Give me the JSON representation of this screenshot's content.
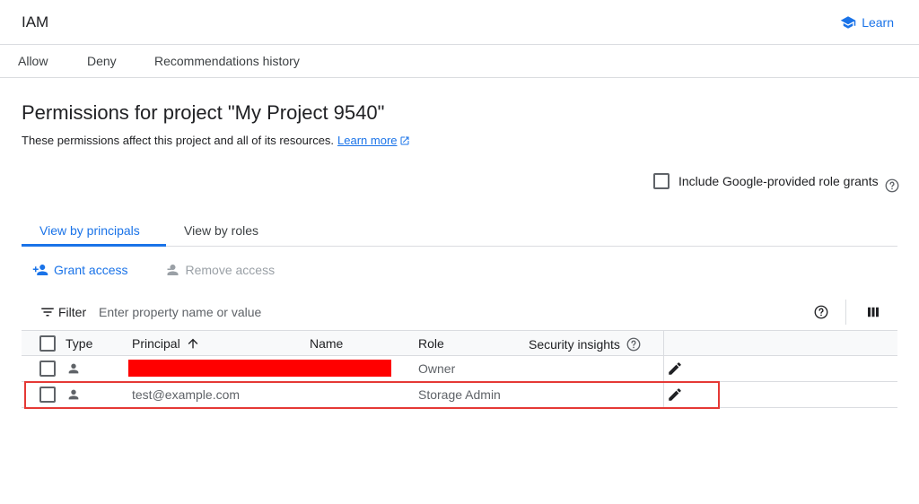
{
  "header": {
    "title": "IAM",
    "learn_label": "Learn"
  },
  "top_tabs": [
    {
      "label": "Allow"
    },
    {
      "label": "Deny"
    },
    {
      "label": "Recommendations history"
    }
  ],
  "page": {
    "title": "Permissions for project \"My Project 9540\"",
    "description": "These permissions affect this project and all of its resources.",
    "learn_more": "Learn more",
    "include_label": "Include Google-provided role grants",
    "include_checked": false
  },
  "view_tabs": [
    {
      "label": "View by principals",
      "active": true
    },
    {
      "label": "View by roles",
      "active": false
    }
  ],
  "actions": {
    "grant": "Grant access",
    "remove": "Remove access"
  },
  "filter": {
    "label": "Filter",
    "placeholder": "Enter property name or value"
  },
  "table": {
    "columns": {
      "type": "Type",
      "principal": "Principal",
      "name": "Name",
      "role": "Role",
      "insights": "Security insights"
    },
    "sort": {
      "column": "principal",
      "direction": "ascending"
    },
    "rows": [
      {
        "principal": "",
        "principal_redacted": true,
        "name": "",
        "role": "Owner"
      },
      {
        "principal": "test@example.com",
        "principal_redacted": false,
        "name": "",
        "role": "Storage Admin",
        "highlighted": true
      }
    ]
  },
  "colors": {
    "accent": "#1a73e8",
    "redaction": "#ff0000",
    "highlight": "#e53935"
  }
}
